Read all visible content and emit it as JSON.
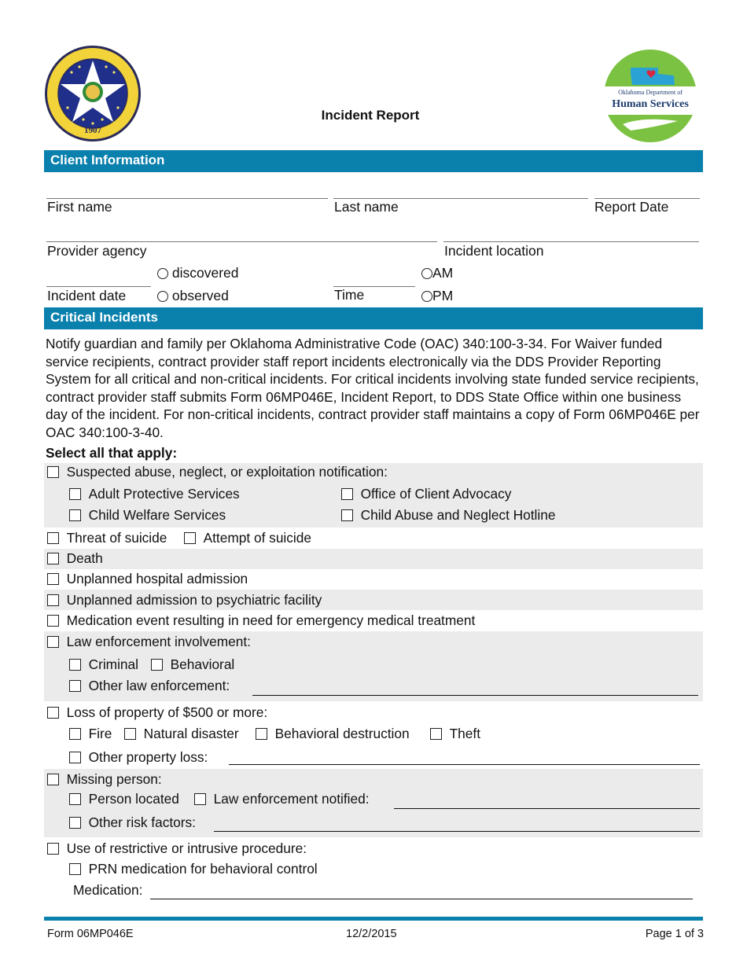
{
  "header": {
    "title": "Incident Report",
    "left_logo": "Great Seal of the State of Oklahoma 1907",
    "right_logo": "Oklahoma Department of Human Services"
  },
  "client_information": {
    "section_title": "Client Information",
    "fields": {
      "first_name": "First name",
      "last_name": "Last name",
      "report_date": "Report Date",
      "provider_agency": "Provider agency",
      "incident_location": "Incident location",
      "incident_date": "Incident date",
      "time": "Time"
    },
    "date_type_options": [
      "discovered",
      "observed"
    ],
    "ampm_options": [
      "AM",
      "PM"
    ]
  },
  "critical_incidents": {
    "section_title": "Critical Incidents",
    "instructions": "Notify guardian and family per Oklahoma Administrative Code (OAC) 340:100-3-34. For Waiver funded service recipients, contract provider staff report incidents electronically via the DDS Provider Reporting System for all critical and non-critical incidents. For critical incidents involving state funded service recipients, contract provider staff submits Form 06MP046E, Incident Report, to DDS State Office within one business day of the incident. For non-critical incidents, contract provider staff maintains a copy of Form 06MP046E per OAC 340:100-3-40.",
    "select_label": "Select all that apply:",
    "abuse": {
      "label": "Suspected abuse, neglect, or exploitation notification:",
      "options": [
        "Adult Protective Services",
        "Office of Client Advocacy",
        "Child Welfare Services",
        "Child Abuse and Neglect Hotline"
      ]
    },
    "suicide": {
      "threat": "Threat of suicide",
      "attempt": "Attempt of suicide"
    },
    "death": "Death",
    "hospital": "Unplanned hospital admission",
    "psychiatric": "Unplanned admission to psychiatric facility",
    "medication_event": "Medication event resulting in need for emergency medical treatment",
    "law": {
      "label": "Law enforcement involvement:",
      "criminal": "Criminal",
      "behavioral": "Behavioral",
      "other": "Other law enforcement:"
    },
    "property": {
      "label": "Loss of property of $500 or more:",
      "options": [
        "Fire",
        "Natural disaster",
        "Behavioral destruction",
        "Theft"
      ],
      "other": "Other property loss:"
    },
    "missing": {
      "label": "Missing person:",
      "located": "Person located",
      "law_notified": "Law enforcement notified:",
      "other_risk": "Other risk factors:"
    },
    "restrictive": {
      "label": "Use of restrictive or intrusive procedure:",
      "prn": "PRN medication for behavioral control",
      "medication": "Medication:"
    }
  },
  "footer": {
    "form_number": "Form 06MP046E",
    "date": "12/2/2015",
    "page": "Page 1 of 3"
  },
  "colors": {
    "accent": "#0a80ad",
    "band": "#ebebeb"
  }
}
